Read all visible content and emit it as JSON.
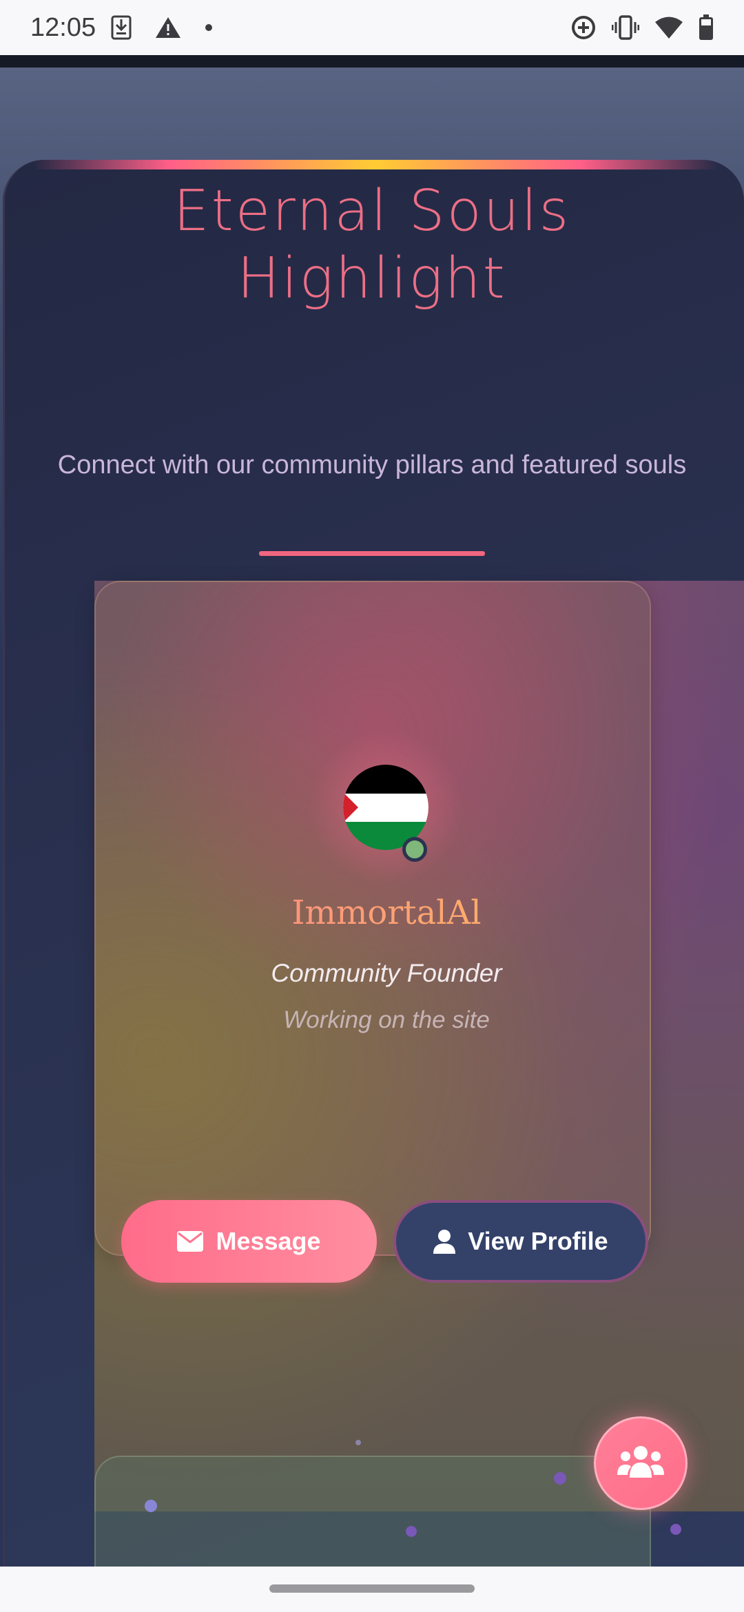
{
  "status_bar": {
    "time": "12:05",
    "left_icons": [
      "sim-save-icon",
      "warning-icon",
      "dot-icon"
    ],
    "right_icons": [
      "data-saver-icon",
      "vibrate-icon",
      "wifi-icon",
      "battery-icon"
    ]
  },
  "hero": {
    "title_line1": "Eternal Souls",
    "title_line2": "Highlight",
    "subtitle": "Connect with our community pillars and featured souls",
    "accent_colors": [
      "#ff5f88",
      "#ffcc33"
    ]
  },
  "profile_card": {
    "avatar_icon": "palestine-flag-icon",
    "online": true,
    "name": "ImmortalAl",
    "role": "Community Founder",
    "status": "Working on the site",
    "message_label": "Message",
    "message_icon": "envelope-icon",
    "view_profile_label": "View Profile",
    "view_profile_icon": "user-icon"
  },
  "fab": {
    "icon": "users-group-icon"
  },
  "colors": {
    "accent_pink": "#ff6c8a",
    "title_pink": "#ec6f86",
    "profile_button": "#34426a"
  }
}
